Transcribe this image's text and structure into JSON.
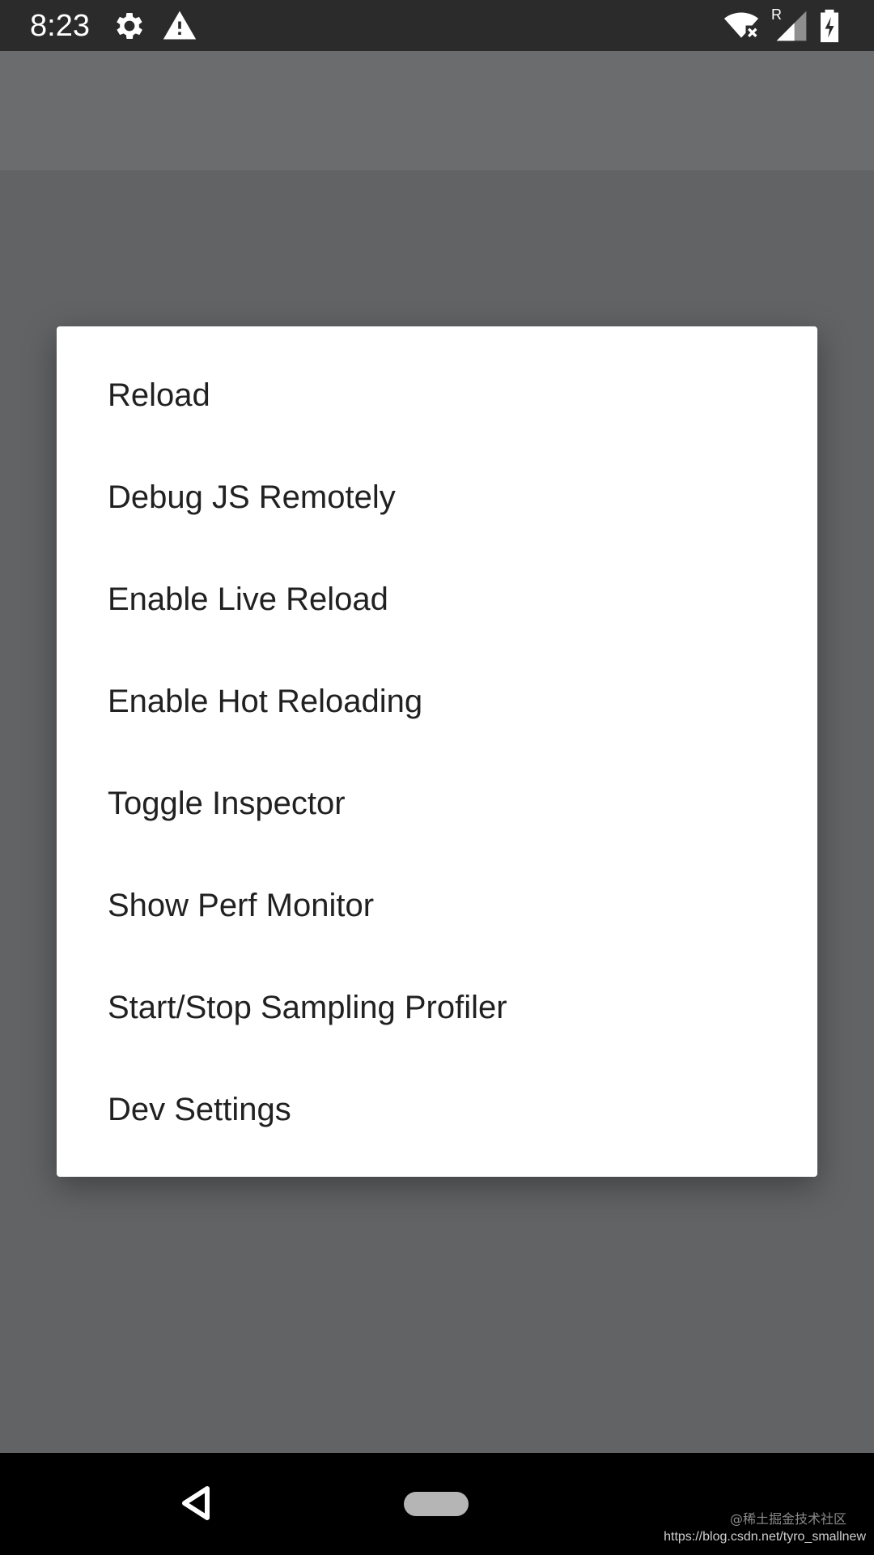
{
  "status_bar": {
    "time": "8:23",
    "left_icons": [
      "gear-icon",
      "warning-icon"
    ],
    "right_icons": [
      "wifi-no-internet-icon",
      "cell-signal-roaming-icon",
      "battery-charging-icon"
    ],
    "roaming_label": "R"
  },
  "menu": {
    "items": [
      {
        "label": "Reload"
      },
      {
        "label": "Debug JS Remotely"
      },
      {
        "label": "Enable Live Reload"
      },
      {
        "label": "Enable Hot Reloading"
      },
      {
        "label": "Toggle Inspector"
      },
      {
        "label": "Show Perf Monitor"
      },
      {
        "label": "Start/Stop Sampling Profiler"
      },
      {
        "label": "Dev Settings"
      }
    ]
  },
  "nav_bar": {
    "icons": [
      "back-icon",
      "home-pill"
    ]
  },
  "watermark": {
    "line1": "@稀土掘金技术社区",
    "line2": "https://blog.csdn.net/tyro_smallnew"
  },
  "colors": {
    "status_bar": "#2b2b2c",
    "scrim": "#626365",
    "dialog": "#ffffff",
    "menu_text": "#212121",
    "nav_bar": "#000000"
  }
}
